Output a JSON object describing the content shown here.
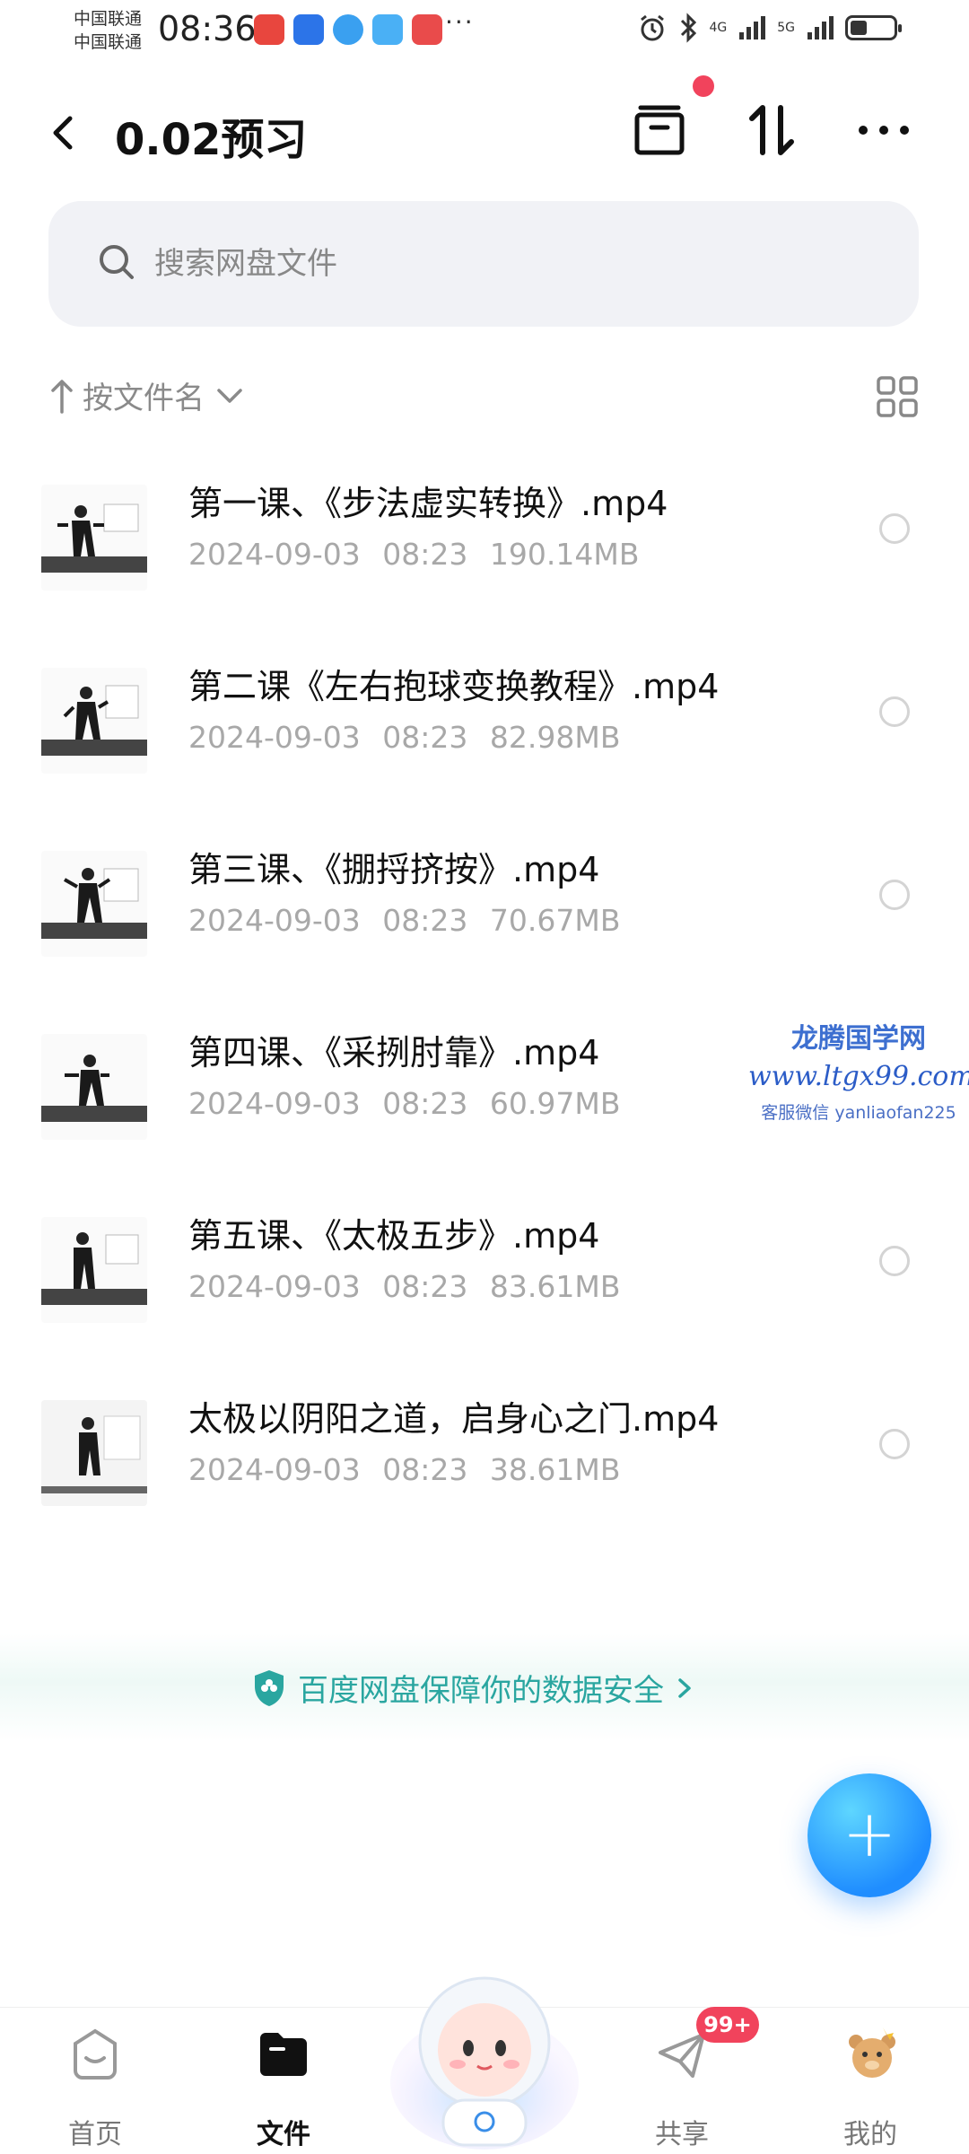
{
  "status_bar": {
    "carrier_1": "中国联通",
    "carrier_2": "中国联通",
    "time": "08:36",
    "more": "···",
    "network_1": "4G",
    "network_2": "5G"
  },
  "header": {
    "title": "0.02预习"
  },
  "search": {
    "placeholder": "搜索网盘文件"
  },
  "sort": {
    "label": "按文件名"
  },
  "files": [
    {
      "name": "第一课、《步法虚实转换》.mp4",
      "date": "2024-09-03",
      "time": "08:23",
      "size": "190.14MB"
    },
    {
      "name": "第二课《左右抱球变换教程》.mp4",
      "date": "2024-09-03",
      "time": "08:23",
      "size": "82.98MB"
    },
    {
      "name": "第三课、《掤捋挤按》.mp4",
      "date": "2024-09-03",
      "time": "08:23",
      "size": "70.67MB"
    },
    {
      "name": "第四课、《采挒肘靠》.mp4",
      "date": "2024-09-03",
      "time": "08:23",
      "size": "60.97MB"
    },
    {
      "name": "第五课、《太极五步》.mp4",
      "date": "2024-09-03",
      "time": "08:23",
      "size": "83.61MB"
    },
    {
      "name": "太极以阴阳之道，启身心之门.mp4",
      "date": "2024-09-03",
      "time": "08:23",
      "size": "38.61MB"
    }
  ],
  "watermark": {
    "line1": "龙腾国学网",
    "line2": "www.ltgx99.com",
    "line3": "客服微信 yanliaofan225"
  },
  "security_banner": {
    "text": "百度网盘保障你的数据安全"
  },
  "fab": {
    "label": "+"
  },
  "nav": {
    "home": "首页",
    "files": "文件",
    "share": "共享",
    "mine": "我的",
    "share_badge": "99+"
  },
  "colors": {
    "accent_red": "#f1435c",
    "fab_blue": "#1f8dff",
    "secure_teal": "#2aa6a0"
  }
}
